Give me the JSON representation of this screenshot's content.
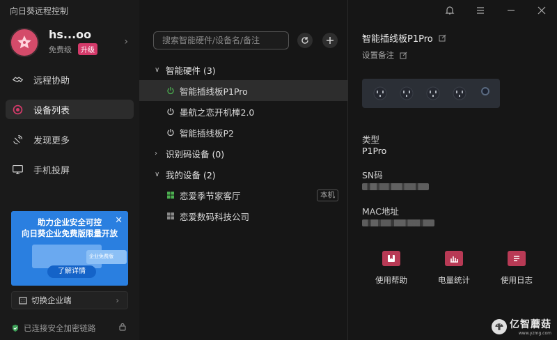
{
  "app": {
    "title": "向日葵远程控制"
  },
  "profile": {
    "username": "hs...oo",
    "plan": "免费级",
    "upgrade_label": "升级"
  },
  "sidebar": {
    "items": [
      {
        "label": "远程协助",
        "icon": "handshake-icon"
      },
      {
        "label": "设备列表",
        "icon": "device-list-icon",
        "active": true
      },
      {
        "label": "发现更多",
        "icon": "satellite-icon"
      },
      {
        "label": "手机投屏",
        "icon": "screen-cast-icon"
      }
    ],
    "promo": {
      "line1": "助力企业安全可控",
      "line2": "向日葵企业免费版限量开放",
      "card_label": "企业免费版",
      "button": "了解详情"
    },
    "switch_enterprise": "切换企业端",
    "secure_status": "已连接安全加密链路"
  },
  "middle": {
    "search_placeholder": "搜索智能硬件/设备名/备注",
    "groups": [
      {
        "label": "智能硬件 (3)",
        "items": [
          {
            "label": "智能插线板P1Pro",
            "icon": "power-icon",
            "selected": true
          },
          {
            "label": "墨航之恋开机棒2.0",
            "icon": "power-icon"
          },
          {
            "label": "智能插线板P2",
            "icon": "power-icon"
          }
        ]
      },
      {
        "label": "识别码设备 (0)",
        "items": []
      },
      {
        "label": "我的设备 (2)",
        "items": [
          {
            "label": "恋爱季节家客厅",
            "icon": "windows-icon",
            "badge": "本机"
          },
          {
            "label": "恋爱数码科技公司",
            "icon": "windows-icon"
          }
        ]
      }
    ]
  },
  "detail": {
    "name": "智能插线板P1Pro",
    "remark_label": "设置备注",
    "type_label": "类型",
    "type_value": "P1Pro",
    "sn_label": "SN码",
    "mac_label": "MAC地址",
    "actions": [
      {
        "label": "使用帮助",
        "icon": "help-book-icon"
      },
      {
        "label": "电量统计",
        "icon": "bar-chart-icon"
      },
      {
        "label": "使用日志",
        "icon": "log-icon"
      }
    ]
  },
  "watermark": {
    "title": "亿智蘑菇",
    "url": "www.yzmg.com"
  },
  "colors": {
    "accent": "#d43a6a",
    "power_green": "#4caf50",
    "promo_blue": "#2a7fe0"
  }
}
